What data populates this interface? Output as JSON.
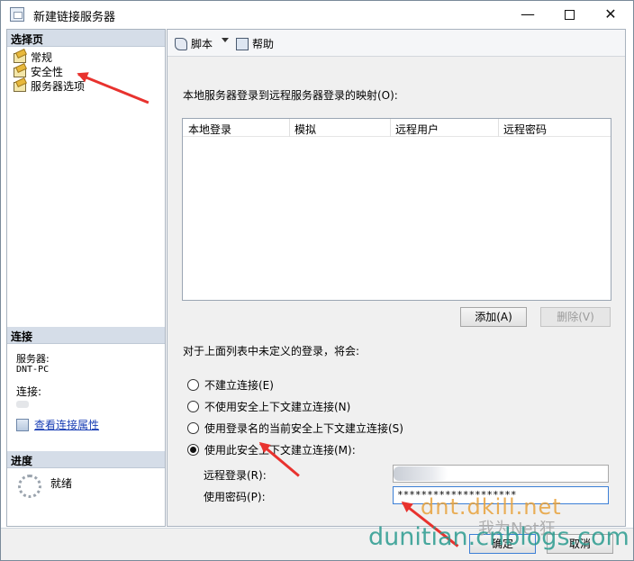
{
  "window": {
    "title": "新建链接服务器"
  },
  "left": {
    "select_page_header": "选择页",
    "pages": [
      {
        "label": "常规"
      },
      {
        "label": "安全性"
      },
      {
        "label": "服务器选项"
      }
    ],
    "connection_header": "连接",
    "server_label": "服务器:",
    "server_value": "DNT-PC",
    "connection_label": "连接:",
    "view_props_link": "查看连接属性",
    "progress_header": "进度",
    "progress_status": "就绪"
  },
  "toolbar": {
    "script_label": "脚本",
    "help_label": "帮助"
  },
  "main": {
    "mapping_label": "本地服务器登录到远程服务器登录的映射(O):",
    "columns": [
      "本地登录",
      "模拟",
      "远程用户",
      "远程密码"
    ],
    "add_button": "添加(A)",
    "delete_button": "删除(V)",
    "undefined_label": "对于上面列表中未定义的登录，将会:",
    "options": [
      {
        "label": "不建立连接(E)",
        "checked": false
      },
      {
        "label": "不使用安全上下文建立连接(N)",
        "checked": false
      },
      {
        "label": "使用登录名的当前安全上下文建立连接(S)",
        "checked": false
      },
      {
        "label": "使用此安全上下文建立连接(M):",
        "checked": true
      }
    ],
    "remote_login_label": "远程登录(R):",
    "password_label": "使用密码(P):",
    "password_value": "********************"
  },
  "footer": {
    "ok_button": "确定",
    "cancel_button": "取消"
  },
  "watermarks": {
    "line1": "dnt.dkill.net",
    "line2": "dunitian.cnblogs.com",
    "line3": "我为Net狂"
  },
  "colors": {
    "accent_red": "#e8322e",
    "link": "#1a3fb5",
    "header_bg": "#d5dde8"
  }
}
